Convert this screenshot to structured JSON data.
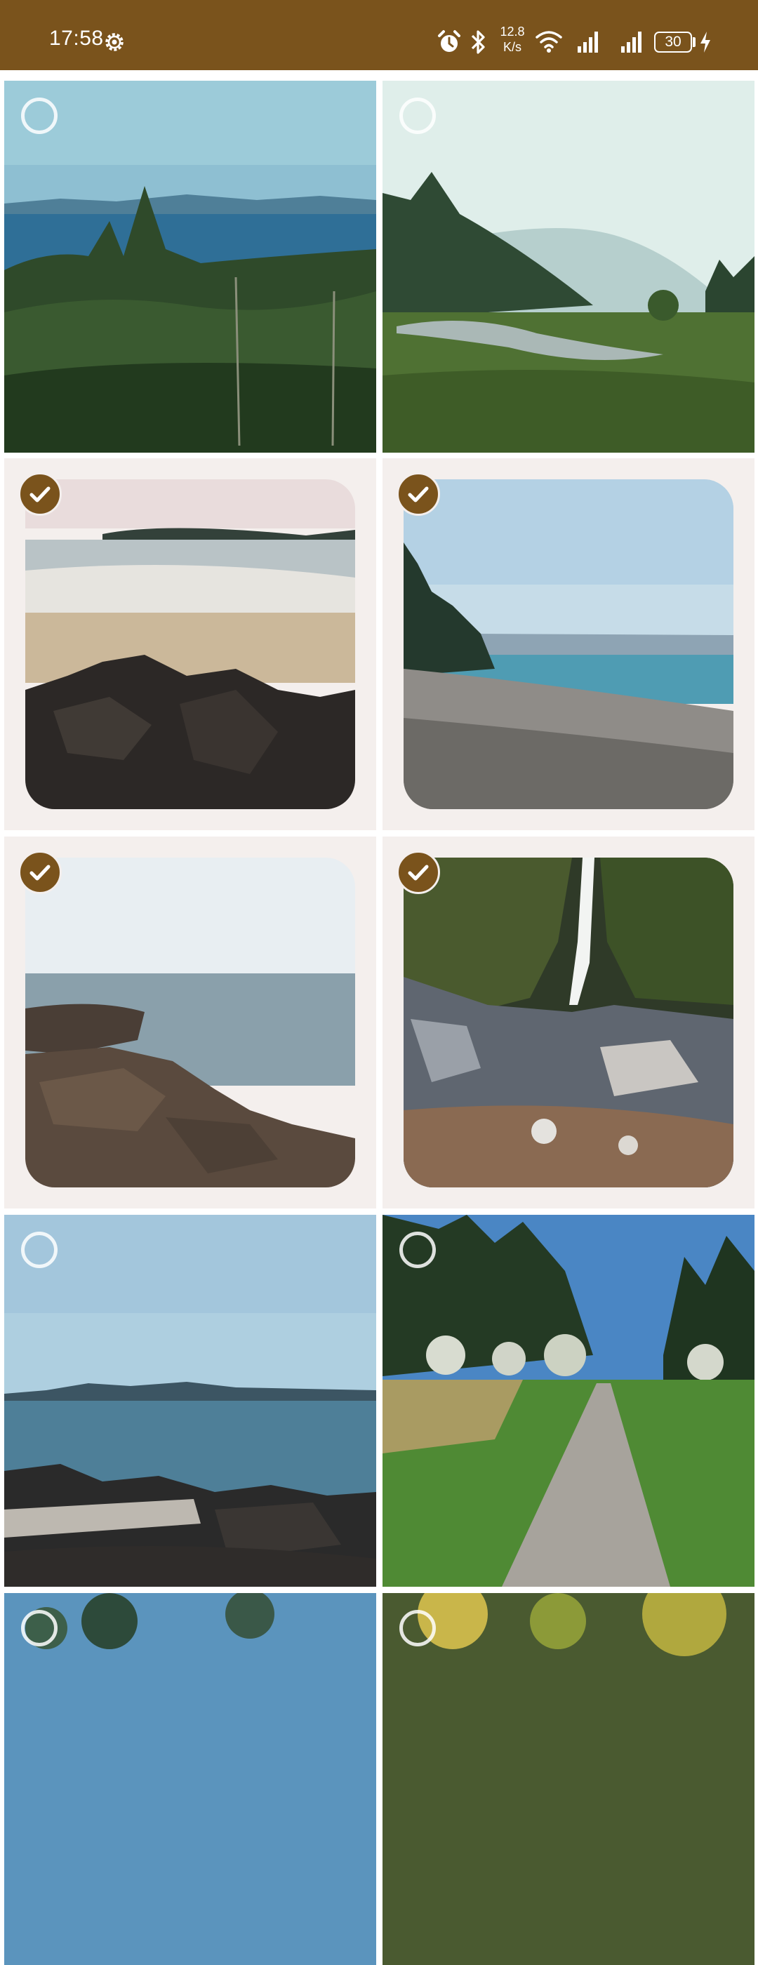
{
  "status_bar": {
    "time": "17:58",
    "network_speed_value": "12.8",
    "network_speed_unit": "K/s",
    "battery_level": "30",
    "icons": [
      "settings-gear-icon",
      "alarm-icon",
      "bluetooth-icon",
      "wifi-icon",
      "signal-icon",
      "signal-icon",
      "battery-icon",
      "charging-bolt-icon"
    ],
    "background_color": "#7a531c"
  },
  "photo_grid": {
    "accent_color": "#7a531c",
    "tiles": [
      {
        "scene": "forest-coast",
        "selected": false
      },
      {
        "scene": "river-valley",
        "selected": false
      },
      {
        "scene": "beach-rocks",
        "selected": true
      },
      {
        "scene": "pebble-shore",
        "selected": true
      },
      {
        "scene": "rocky-coast",
        "selected": true
      },
      {
        "scene": "waterfall",
        "selected": true
      },
      {
        "scene": "sea-driftwood",
        "selected": false
      },
      {
        "scene": "park-path",
        "selected": false
      },
      {
        "scene": "partial-trees-blue",
        "selected": false
      },
      {
        "scene": "partial-trees-yellow",
        "selected": false
      }
    ]
  }
}
